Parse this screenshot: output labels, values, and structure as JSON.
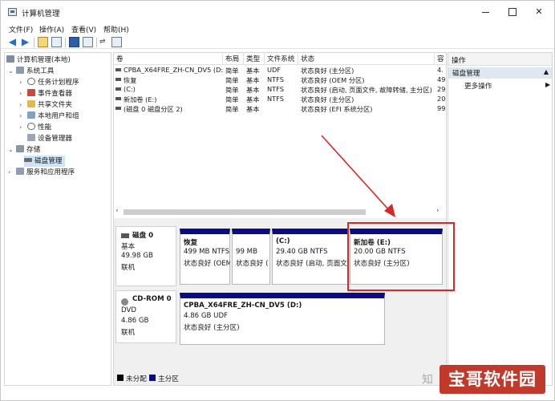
{
  "window": {
    "title": "计算机管理"
  },
  "menu": [
    "文件(F)",
    "操作(A)",
    "查看(V)",
    "帮助(H)"
  ],
  "tree": {
    "root": "计算机管理(本地)",
    "system_tools": "系统工具",
    "task_scheduler": "任务计划程序",
    "event_viewer": "事件查看器",
    "shared_folders": "共享文件夹",
    "local_users": "本地用户和组",
    "performance": "性能",
    "device_manager": "设备管理器",
    "storage": "存储",
    "disk_management": "磁盘管理",
    "services": "服务和应用程序"
  },
  "volumes": {
    "headers": [
      "卷",
      "布局",
      "类型",
      "文件系统",
      "状态",
      "容"
    ],
    "rows": [
      {
        "name": "CPBA_X64FRE_ZH-CN_DV5 (D:)",
        "layout": "简单",
        "type": "基本",
        "fs": "UDF",
        "status": "状态良好 (主分区)",
        "cap": "4."
      },
      {
        "name": "恢复",
        "layout": "简单",
        "type": "基本",
        "fs": "NTFS",
        "status": "状态良好 (OEM 分区)",
        "cap": "49"
      },
      {
        "name": "(C:)",
        "layout": "简单",
        "type": "基本",
        "fs": "NTFS",
        "status": "状态良好 (启动, 页面文件, 故障转储, 主分区)",
        "cap": "29"
      },
      {
        "name": "新加卷 (E:)",
        "layout": "简单",
        "type": "基本",
        "fs": "NTFS",
        "status": "状态良好 (主分区)",
        "cap": "20"
      },
      {
        "name": "(磁盘 0 磁盘分区 2)",
        "layout": "简单",
        "type": "基本",
        "fs": "",
        "status": "状态良好 (EFI 系统分区)",
        "cap": "99"
      }
    ]
  },
  "disk0": {
    "label": "磁盘 0",
    "type": "基本",
    "size": "49.98 GB",
    "state": "联机",
    "partitions": [
      {
        "name": "恢复",
        "size": "499 MB NTFS",
        "status": "状态良好 (OEM"
      },
      {
        "name": "",
        "size": "99 MB",
        "status": "状态良好 ("
      },
      {
        "name": "(C:)",
        "size": "29.40 GB NTFS",
        "status": "状态良好 (启动, 页面文件,"
      },
      {
        "name": "新加卷 (E:)",
        "size": "20.00 GB NTFS",
        "status": "状态良好 (主分区)"
      }
    ]
  },
  "cdrom0": {
    "label": "CD-ROM 0",
    "type": "DVD",
    "size": "4.86 GB",
    "state": "联机",
    "partition": {
      "name": "CPBA_X64FRE_ZH-CN_DV5 (D:)",
      "size": "4.86 GB UDF",
      "status": "状态良好 (主分区)"
    }
  },
  "legend": {
    "unallocated": "未分配",
    "primary": "主分区"
  },
  "actions": {
    "header": "操作",
    "section": "磁盘管理",
    "more": "更多操作"
  },
  "watermark": {
    "prefix": "知",
    "text": "宝哥软件园"
  },
  "colors": {
    "partition_bar": "#0b0b82",
    "annotation": "#d62828",
    "selection": "#cce4f7",
    "watermark": "#c0392b"
  }
}
